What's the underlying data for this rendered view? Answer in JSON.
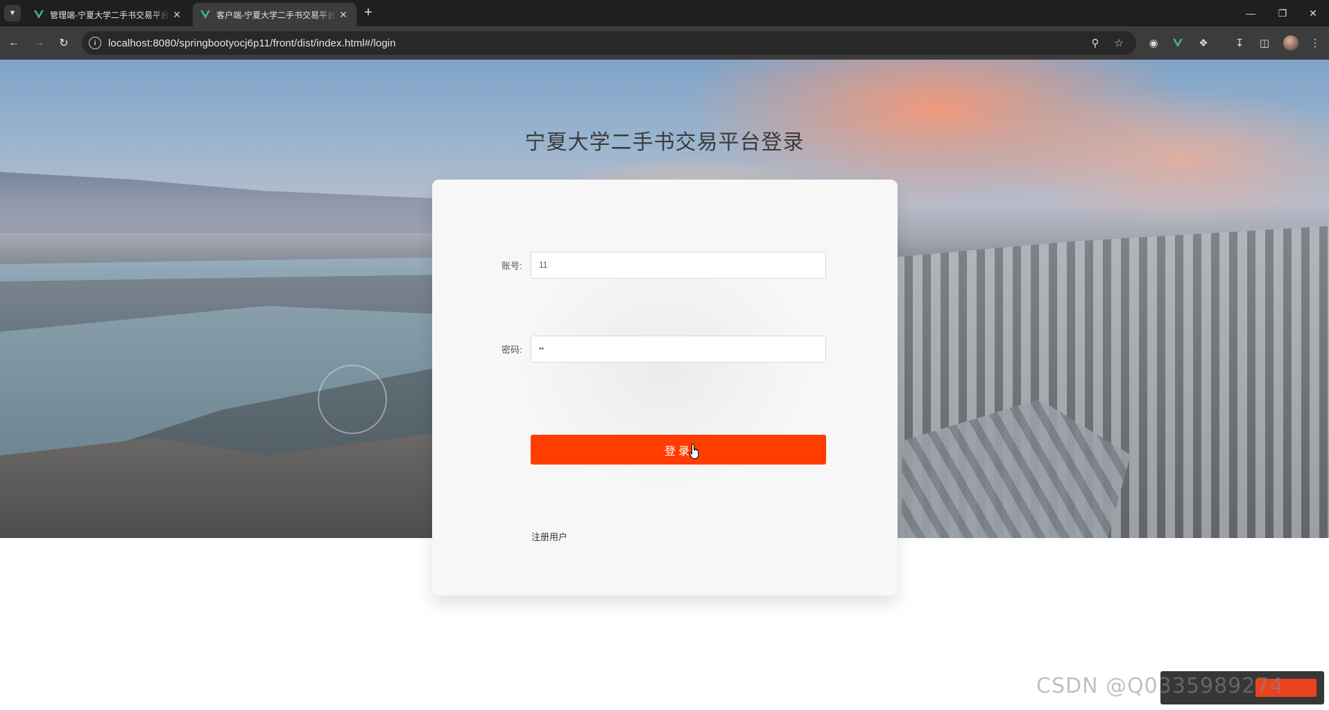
{
  "browser": {
    "tabs": [
      {
        "title": "管理端-宁夏大学二手书交易平台",
        "active": false
      },
      {
        "title": "客户端-宁夏大学二手书交易平台",
        "active": true
      }
    ],
    "url": "localhost:8080/springbootyocj6p11/front/dist/index.html#/login"
  },
  "page": {
    "title": "宁夏大学二手书交易平台登录",
    "account_label": "账号:",
    "account_value": "11",
    "password_label": "密码:",
    "password_value": "••",
    "login_button": "登录",
    "register_link": "注册用户"
  },
  "overlay": {
    "watermark": "CSDN @Q0335989274"
  },
  "colors": {
    "accent": "#ff3d00",
    "vue_green": "#41b883"
  },
  "icons": {
    "back": "arrow-left-icon",
    "forward": "arrow-right-icon",
    "reload": "reload-icon",
    "site_info": "info-icon",
    "password_key": "key-icon",
    "bookmark": "star-icon",
    "extensions": "puzzle-icon",
    "downloads": "download-icon",
    "side_panel": "side-panel-icon"
  }
}
